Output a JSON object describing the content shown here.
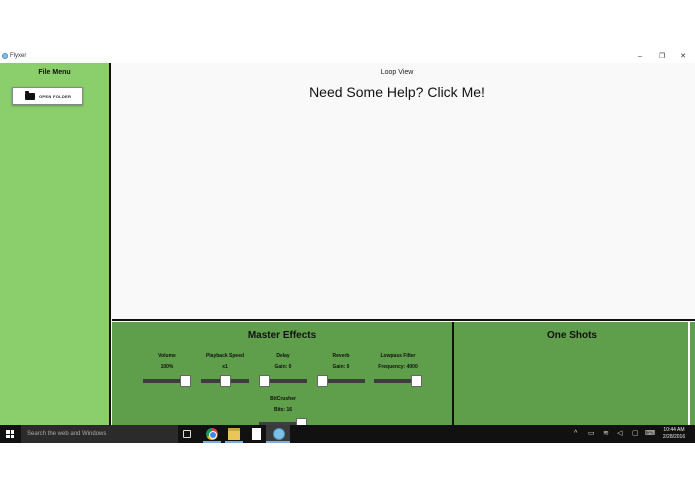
{
  "window": {
    "title": "Flyxer",
    "controls": {
      "minimize": "–",
      "maximize": "❐",
      "close": "✕"
    }
  },
  "sidebar": {
    "title": "File Menu",
    "open_folder_label": "OPEN FOLDER"
  },
  "loop_view": {
    "title": "Loop View",
    "help_text": "Need Some Help? Click Me!"
  },
  "master_effects": {
    "title": "Master Effects",
    "effects": [
      {
        "name": "Volume",
        "value": "100%",
        "level": 1.0
      },
      {
        "name": "Playback Speed",
        "value": "x1",
        "level": 0.5
      },
      {
        "name": "Delay",
        "value": "Gain: 0",
        "level": 0.0
      },
      {
        "name": "Reverb",
        "value": "Gain: 0",
        "level": 0.0
      },
      {
        "name": "Lowpass Filter",
        "value": "Frequency: 4000",
        "level": 1.0
      },
      {
        "name": "BitCrusher",
        "value": "Bits: 16",
        "level": 1.0
      }
    ]
  },
  "one_shots": {
    "title": "One Shots"
  },
  "taskbar": {
    "search_placeholder": "Search the web and Windows",
    "time": "10:44 AM",
    "date": "2/28/2016",
    "icons": [
      "windows-start-icon",
      "task-view-icon",
      "chrome-icon",
      "file-explorer-icon",
      "document-icon",
      "flyxer-app-icon"
    ],
    "tray_icons": [
      "chevron-up-icon",
      "battery-icon",
      "wifi-icon",
      "volume-icon",
      "notification-icon",
      "keyboard-icon"
    ]
  }
}
